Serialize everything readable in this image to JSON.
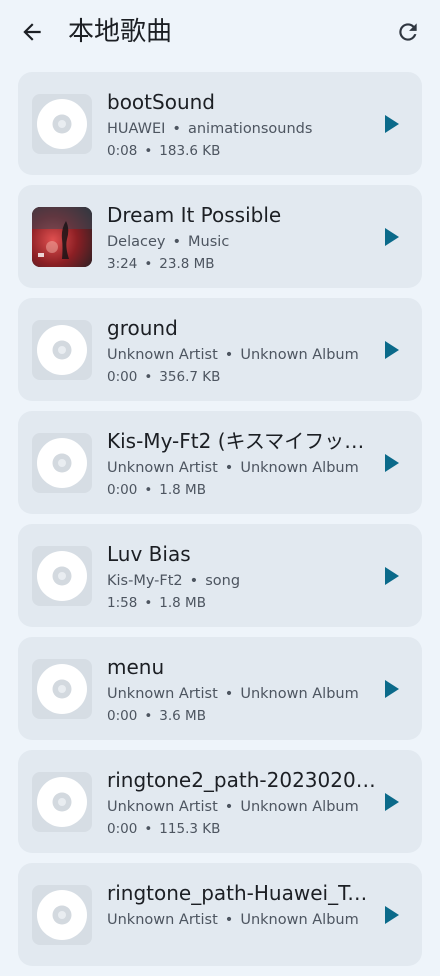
{
  "header": {
    "title": "本地歌曲"
  },
  "songs": [
    {
      "title": "bootSound",
      "artist": "HUAWEI",
      "album": "animationsounds",
      "duration": "0:08",
      "size": "183.6 KB",
      "cover": "disc"
    },
    {
      "title": "Dream It Possible",
      "artist": "Delacey",
      "album": "Music",
      "duration": "3:24",
      "size": "23.8 MB",
      "cover": "art"
    },
    {
      "title": "ground",
      "artist": "Unknown Artist",
      "album": "Unknown Album",
      "duration": "0:00",
      "size": "356.7 KB",
      "cover": "disc"
    },
    {
      "title": "Kis-My-Ft2 (キスマイフッ…",
      "artist": "Unknown Artist",
      "album": "Unknown Album",
      "duration": "0:00",
      "size": "1.8 MB",
      "cover": "disc"
    },
    {
      "title": "Luv Bias",
      "artist": "Kis-My-Ft2",
      "album": "song",
      "duration": "1:58",
      "size": "1.8 MB",
      "cover": "disc"
    },
    {
      "title": "menu",
      "artist": "Unknown Artist",
      "album": "Unknown Album",
      "duration": "0:00",
      "size": "3.6 MB",
      "cover": "disc"
    },
    {
      "title": "ringtone2_path-2023020…",
      "artist": "Unknown Artist",
      "album": "Unknown Album",
      "duration": "0:00",
      "size": "115.3 KB",
      "cover": "disc"
    },
    {
      "title": "ringtone_path-Huawei_Tu…",
      "artist": "Unknown Artist",
      "album": "Unknown Album",
      "duration": "",
      "size": "",
      "cover": "disc"
    }
  ],
  "icons": {
    "back": "arrow-back-icon",
    "refresh": "refresh-icon",
    "play": "play-icon",
    "disc": "disc-icon"
  },
  "colors": {
    "background": "#eef4fa",
    "card": "#e2e9f0",
    "play_accent": "#0b6a8a"
  }
}
